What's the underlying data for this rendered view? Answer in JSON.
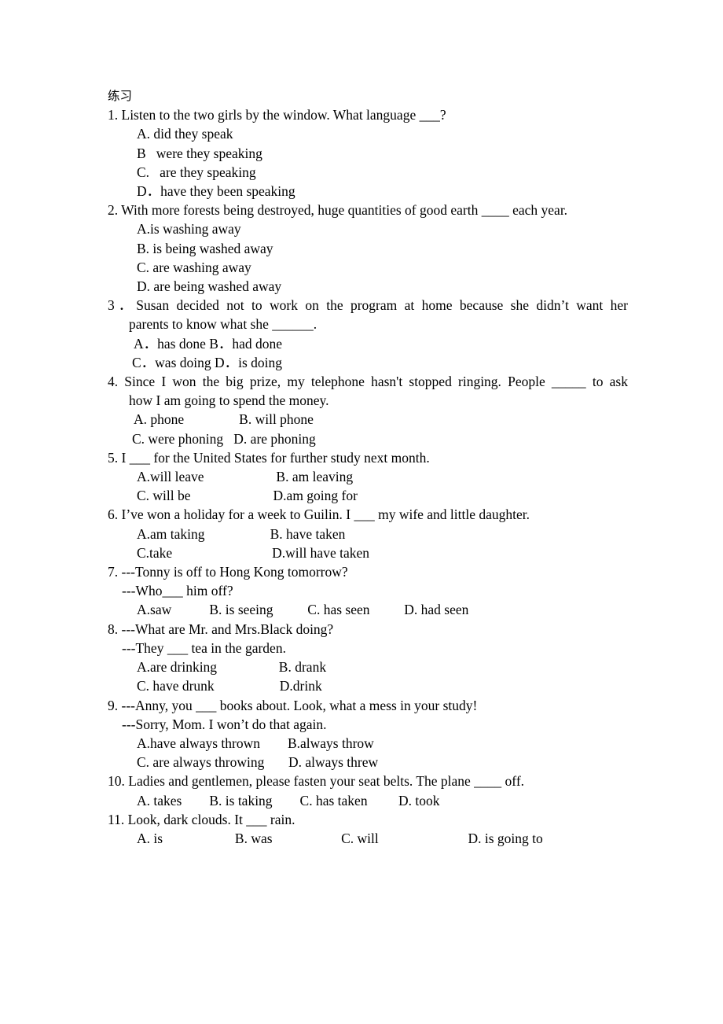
{
  "document": {
    "title_cn": "练习",
    "items": [
      {
        "number": "1.",
        "stem": "1. Listen to the two girls by the window. What language ___?",
        "options": [
          "A. did they speak",
          "B   were they speaking",
          "C.   are they speaking",
          "D．have they been speaking"
        ]
      },
      {
        "number": "2.",
        "stem": "2. With more forests being destroyed, huge quantities of good earth ____ each year.",
        "options": [
          "A.is washing away",
          "B. is being washed away",
          "C. are washing away",
          "D. are being washed away"
        ]
      },
      {
        "number": "3．",
        "stem_line1": "3．Susan decided not to work on the program at home because she didn’t want her",
        "stem_line2": "parents to know what she ______.",
        "options": [
          "A．has done B．had done",
          "C．was doing D．is doing"
        ]
      },
      {
        "number": "4.",
        "stem_line1": "4. Since I won the big prize, my telephone hasn't stopped ringing. People _____ to ask",
        "stem_line2": "how I am going to spend the money.",
        "options": [
          "A. phone                B. will phone",
          "C. were phoning   D. are phoning"
        ]
      },
      {
        "number": "5.",
        "stem": "5. I ___ for the United States for further study next month.",
        "options": [
          "A.will leave                     B. am leaving",
          "C. will be                        D.am going for"
        ]
      },
      {
        "number": "6.",
        "stem": "6. I’ve won a holiday for a week to Guilin. I ___ my wife and little daughter.",
        "options": [
          "A.am taking                   B. have taken",
          "C.take                             D.will have taken"
        ]
      },
      {
        "number": "7.",
        "stem_line1": "7. ---Tonny is off to Hong Kong tomorrow?",
        "stem_line2": "---Who___ him off?",
        "options": [
          "A.saw           B. is seeing          C. has seen          D. had seen"
        ]
      },
      {
        "number": "8.",
        "stem_line1": "8. ---What are Mr. and Mrs.Black doing?",
        "stem_line2": "---They ___ tea in the garden.",
        "options": [
          "A.are drinking                  B. drank",
          "C. have drunk                   D.drink"
        ]
      },
      {
        "number": "9.",
        "stem_line1": "9. ---Anny, you ___ books about. Look, what a mess in your study!",
        "stem_line2": "---Sorry, Mom. I won’t do that again.",
        "options": [
          "A.have always thrown        B.always throw",
          "C. are always throwing       D. always threw"
        ]
      },
      {
        "number": "10.",
        "stem": "10. Ladies and gentlemen, please fasten your seat belts. The plane ____ off.",
        "options": [
          "A. takes        B. is taking        C. has taken         D. took"
        ]
      },
      {
        "number": "11.",
        "stem": "11. Look, dark clouds. It ___ rain.",
        "options": [
          "A. is                     B. was                    C. will                          D. is going to"
        ]
      }
    ]
  }
}
